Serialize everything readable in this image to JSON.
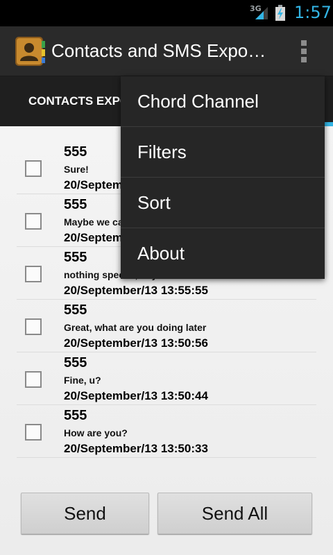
{
  "status_bar": {
    "network": "3G",
    "time": "1:57",
    "accent": "#33b5e5"
  },
  "action_bar": {
    "title": "Contacts and SMS Expo…",
    "app_icon": "contacts-book-icon",
    "overflow_icon": "overflow-menu-icon"
  },
  "tabs": [
    {
      "label": "CONTACTS EXPO"
    }
  ],
  "messages": [
    {
      "sender": "555",
      "text": "Sure!",
      "date": "20/Septem"
    },
    {
      "sender": "555",
      "text": "Maybe we ca",
      "date": "20/Septem"
    },
    {
      "sender": "555",
      "text": "nothing special, any ideas?",
      "date": "20/September/13  13:55:55"
    },
    {
      "sender": "555",
      "text": "Great, what are you doing later",
      "date": "20/September/13  13:50:56"
    },
    {
      "sender": "555",
      "text": "Fine, u?",
      "date": "20/September/13  13:50:44"
    },
    {
      "sender": "555",
      "text": "How are you?",
      "date": "20/September/13  13:50:33"
    }
  ],
  "buttons": {
    "send": "Send",
    "send_all": "Send All"
  },
  "menu": {
    "items": [
      {
        "label": "Chord Channel"
      },
      {
        "label": "Filters"
      },
      {
        "label": "Sort"
      },
      {
        "label": "About"
      }
    ]
  }
}
